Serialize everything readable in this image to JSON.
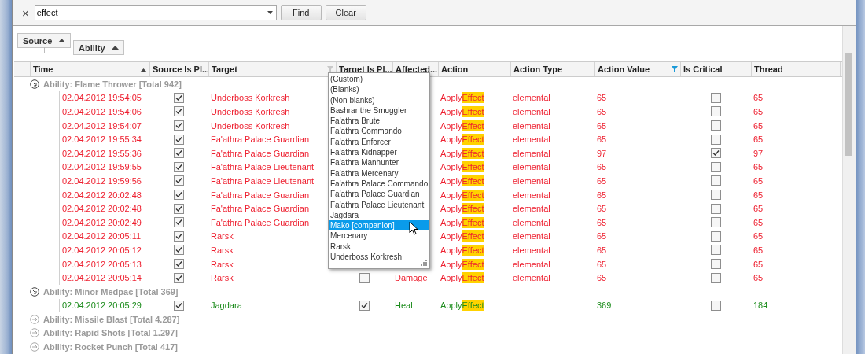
{
  "search": {
    "clear_icon": "×",
    "value": "effect",
    "buttons": [
      "Find",
      "Clear"
    ]
  },
  "group_panel": [
    {
      "label": "Source"
    },
    {
      "label": "Ability"
    }
  ],
  "columns": [
    {
      "label": "Time",
      "sorted": true
    },
    {
      "label": "Source Is Pl..."
    },
    {
      "label": "Target",
      "filtered": true
    },
    {
      "label": "Target Is Pl..."
    },
    {
      "label": "Affected..."
    },
    {
      "label": "Action"
    },
    {
      "label": "Action Type"
    },
    {
      "label": "Action Value",
      "filtered": true
    },
    {
      "label": "Is Critical"
    },
    {
      "label": "Thread"
    }
  ],
  "groups": [
    {
      "label": "Ability: Flame Thrower [Total 942]",
      "expanded": true,
      "rows": [
        {
          "kind": "damage",
          "time": "02.04.2012 19:54:05",
          "source_is_player": true,
          "target": "Underboss Korkresh",
          "action": {
            "before": "Apply",
            "match": "Effect"
          },
          "action_type": "elemental",
          "action_value": "65",
          "is_critical": false,
          "thread": "65"
        },
        {
          "kind": "damage",
          "time": "02.04.2012 19:54:06",
          "source_is_player": true,
          "target": "Underboss Korkresh",
          "action": {
            "before": "Apply",
            "match": "Effect"
          },
          "action_type": "elemental",
          "action_value": "65",
          "is_critical": false,
          "thread": "65"
        },
        {
          "kind": "damage",
          "time": "02.04.2012 19:54:07",
          "source_is_player": true,
          "target": "Underboss Korkresh",
          "action": {
            "before": "Apply",
            "match": "Effect"
          },
          "action_type": "elemental",
          "action_value": "65",
          "is_critical": false,
          "thread": "65"
        },
        {
          "kind": "damage",
          "time": "02.04.2012 19:55:34",
          "source_is_player": true,
          "target": "Fa'athra Palace Guardian",
          "action": {
            "before": "Apply",
            "match": "Effect"
          },
          "action_type": "elemental",
          "action_value": "65",
          "is_critical": false,
          "thread": "65"
        },
        {
          "kind": "damage",
          "time": "02.04.2012 19:55:36",
          "source_is_player": true,
          "target": "Fa'athra Palace Guardian",
          "action": {
            "before": "Apply",
            "match": "Effect"
          },
          "action_type": "elemental",
          "action_value": "97",
          "is_critical": true,
          "thread": "97"
        },
        {
          "kind": "damage",
          "time": "02.04.2012 19:59:55",
          "source_is_player": true,
          "target": "Fa'athra Palace Lieutenant",
          "action": {
            "before": "Apply",
            "match": "Effect"
          },
          "action_type": "elemental",
          "action_value": "65",
          "is_critical": false,
          "thread": "65"
        },
        {
          "kind": "damage",
          "time": "02.04.2012 19:59:56",
          "source_is_player": true,
          "target": "Fa'athra Palace Lieutenant",
          "action": {
            "before": "Apply",
            "match": "Effect"
          },
          "action_type": "elemental",
          "action_value": "65",
          "is_critical": false,
          "thread": "65"
        },
        {
          "kind": "damage",
          "time": "02.04.2012 20:02:48",
          "source_is_player": true,
          "target": "Fa'athra Palace Guardian",
          "action": {
            "before": "Apply",
            "match": "Effect"
          },
          "action_type": "elemental",
          "action_value": "65",
          "is_critical": false,
          "thread": "65"
        },
        {
          "kind": "damage",
          "time": "02.04.2012 20:02:48",
          "source_is_player": true,
          "target": "Fa'athra Palace Guardian",
          "action": {
            "before": "Apply",
            "match": "Effect"
          },
          "action_type": "elemental",
          "action_value": "65",
          "is_critical": false,
          "thread": "65"
        },
        {
          "kind": "damage",
          "time": "02.04.2012 20:02:49",
          "source_is_player": true,
          "target": "Fa'athra Palace Guardian",
          "action": {
            "before": "Apply",
            "match": "Effect"
          },
          "action_type": "elemental",
          "action_value": "65",
          "is_critical": false,
          "thread": "65"
        },
        {
          "kind": "damage",
          "time": "02.04.2012 20:05:11",
          "source_is_player": true,
          "target": "Rarsk",
          "action": {
            "before": "Apply",
            "match": "Effect"
          },
          "action_type": "elemental",
          "action_value": "65",
          "is_critical": false,
          "thread": "65"
        },
        {
          "kind": "damage",
          "time": "02.04.2012 20:05:12",
          "source_is_player": true,
          "target": "Rarsk",
          "action": {
            "before": "Apply",
            "match": "Effect"
          },
          "action_type": "elemental",
          "action_value": "65",
          "is_critical": false,
          "thread": "65"
        },
        {
          "kind": "damage",
          "time": "02.04.2012 20:05:13",
          "source_is_player": true,
          "target": "Rarsk",
          "action": {
            "before": "Apply",
            "match": "Effect"
          },
          "action_type": "elemental",
          "action_value": "65",
          "is_critical": false,
          "thread": "65"
        },
        {
          "kind": "damage",
          "time": "02.04.2012 20:05:14",
          "source_is_player": true,
          "target": "Rarsk",
          "target_is_player": false,
          "affected": "Damage",
          "action": {
            "before": "Apply",
            "match": "Effect"
          },
          "action_type": "elemental",
          "action_value": "65",
          "is_critical": false,
          "thread": "65"
        }
      ]
    },
    {
      "label": "Ability: Minor Medpac [Total 369]",
      "expanded": true,
      "rows": [
        {
          "kind": "heal",
          "time": "02.04.2012 20:05:29",
          "source_is_player": true,
          "target": "Jagdara",
          "target_is_player": true,
          "affected": "Heal",
          "action": {
            "before": "Apply",
            "match": "Effect"
          },
          "action_value": "369",
          "is_critical": false,
          "thread": "184"
        }
      ]
    },
    {
      "label": "Ability: Missile Blast [Total 4.287]",
      "expanded": false
    },
    {
      "label": "Ability: Rapid Shots [Total 1.297]",
      "expanded": false
    },
    {
      "label": "Ability: Rocket Punch [Total 417]",
      "expanded": false
    }
  ],
  "filter_popup": {
    "items": [
      {
        "label": "(Custom)",
        "selected": false
      },
      {
        "label": "(Blanks)",
        "selected": false
      },
      {
        "label": "(Non blanks)",
        "selected": false
      },
      {
        "label": "Bashrar the Smuggler",
        "selected": false
      },
      {
        "label": "Fa'athra Brute",
        "selected": false
      },
      {
        "label": "Fa'athra Commando",
        "selected": false
      },
      {
        "label": "Fa'athra Enforcer",
        "selected": false
      },
      {
        "label": "Fa'athra Kidnapper",
        "selected": false
      },
      {
        "label": "Fa'athra Manhunter",
        "selected": false
      },
      {
        "label": "Fa'athra Mercenary",
        "selected": false
      },
      {
        "label": "Fa'athra Palace Commando",
        "selected": false
      },
      {
        "label": "Fa'athra Palace Guardian",
        "selected": false
      },
      {
        "label": "Fa'athra Palace Lieutenant",
        "selected": false
      },
      {
        "label": "Jagdara",
        "selected": false
      },
      {
        "label": "Mako [companion]",
        "selected": true
      },
      {
        "label": "Mercenary",
        "selected": false
      },
      {
        "label": "Rarsk",
        "selected": false
      },
      {
        "label": "Underboss Korkresh",
        "selected": false
      }
    ]
  }
}
